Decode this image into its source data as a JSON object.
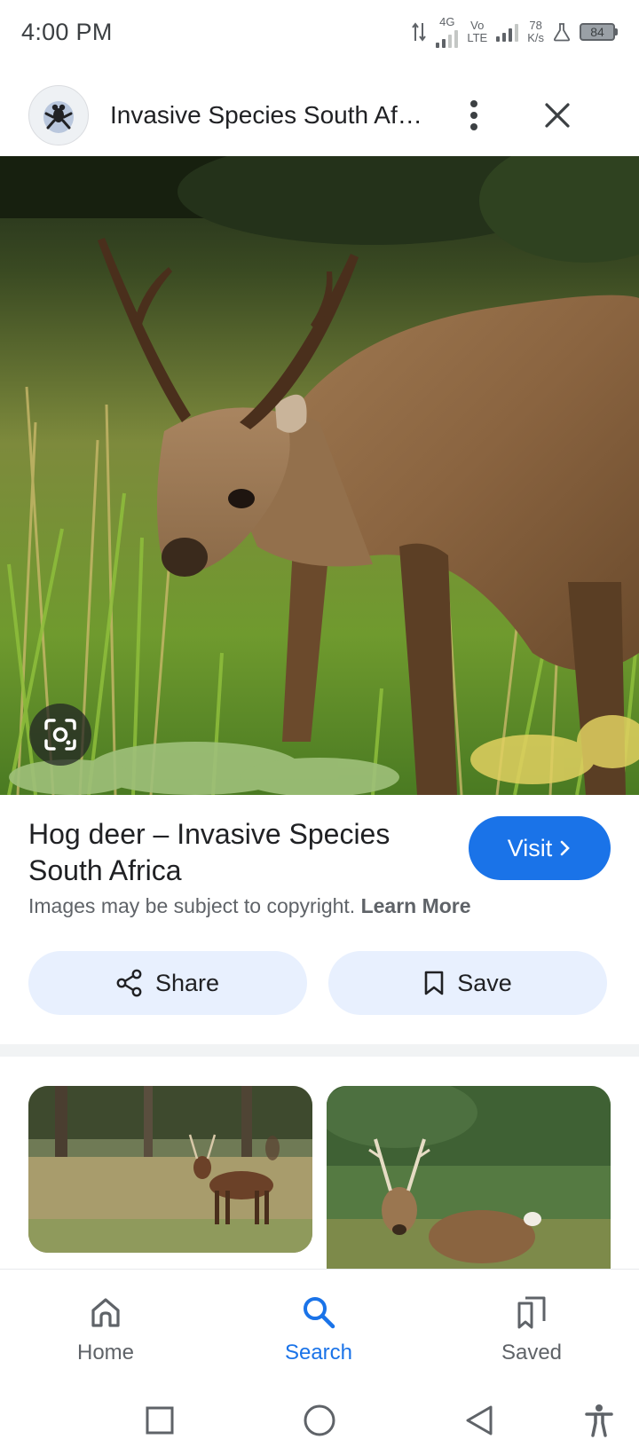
{
  "status_bar": {
    "time": "4:00 PM",
    "net_type_1": "4G",
    "net_type_2": "Vo",
    "net_type_3": "LTE",
    "speed_value": "78",
    "speed_unit": "K/s",
    "battery": "84"
  },
  "header": {
    "title": "Invasive Species South Africa",
    "icons": {
      "site": "frog-logo-icon",
      "more": "more-vert-icon",
      "close": "close-icon"
    }
  },
  "result": {
    "title": "Hog deer – Invasive Species South Africa",
    "visit_label": "Visit",
    "copyright_text": "Images may be subject to copyright.",
    "learn_more_label": "Learn More",
    "share_label": "Share",
    "save_label": "Save"
  },
  "bottom_nav": {
    "items": [
      {
        "label": "Home",
        "icon": "home-icon",
        "active": false
      },
      {
        "label": "Search",
        "icon": "search-icon",
        "active": true
      },
      {
        "label": "Saved",
        "icon": "saved-icon",
        "active": false
      }
    ]
  },
  "colors": {
    "accent": "#1a73e8",
    "tonal_button": "#e8f0fe",
    "text_primary": "#202124",
    "text_secondary": "#5f6368"
  }
}
